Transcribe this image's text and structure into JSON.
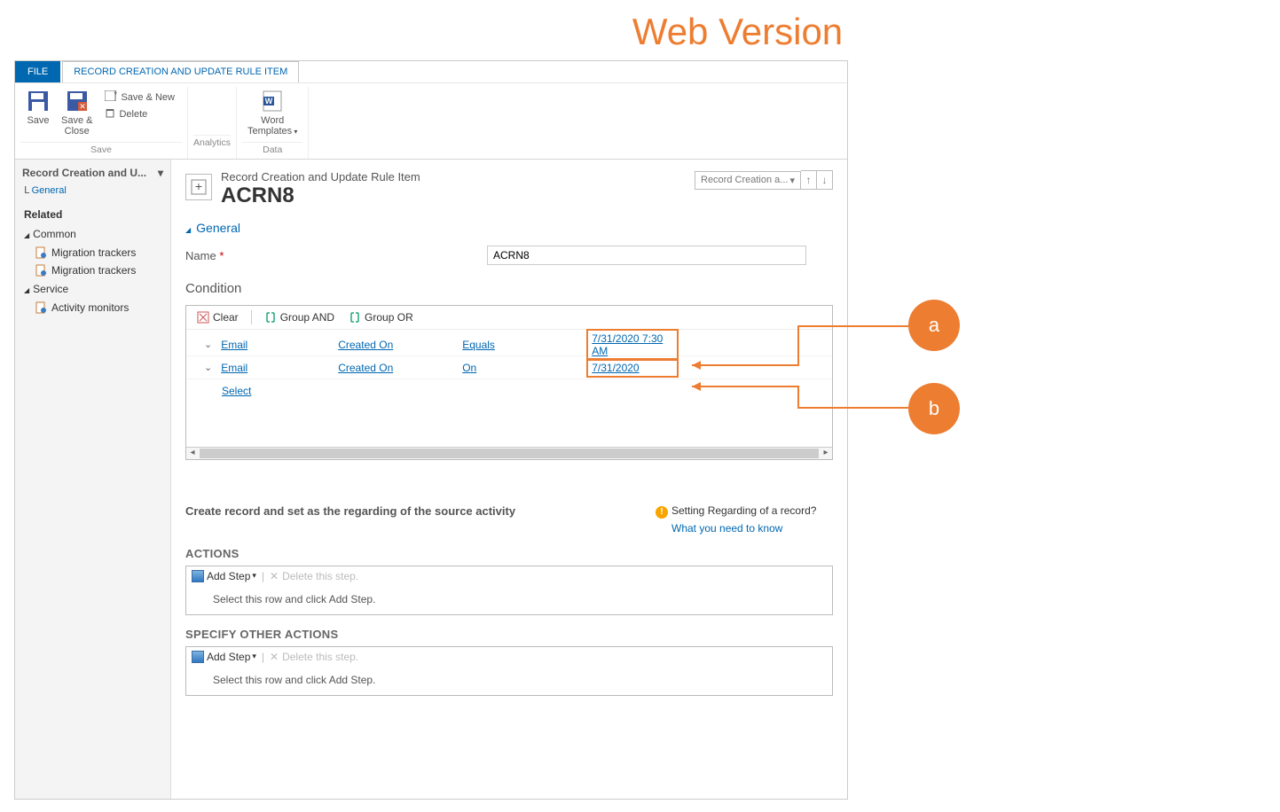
{
  "page": {
    "overlay_title": "Web Version"
  },
  "ribbon": {
    "tabs": {
      "file": "FILE",
      "ruleitem": "RECORD CREATION AND UPDATE RULE ITEM"
    },
    "groups": {
      "save": {
        "save": "Save",
        "save_close": "Save &\nClose",
        "save_new": "Save & New",
        "delete": "Delete",
        "label": "Save"
      },
      "analytics": {
        "label": "Analytics"
      },
      "data": {
        "word_templates": "Word\nTemplates",
        "label": "Data"
      }
    }
  },
  "sidebar": {
    "breadcrumb": "Record Creation and U...",
    "general": "General",
    "related": "Related",
    "common": "Common",
    "common_items": [
      "Migration trackers",
      "Migration trackers"
    ],
    "service": "Service",
    "service_items": [
      "Activity monitors"
    ]
  },
  "header": {
    "subtype": "Record Creation and Update Rule Item",
    "title": "ACRN8",
    "selector": "Record Creation a..."
  },
  "form": {
    "section_general": "General",
    "name_label": "Name",
    "name_value": "ACRN8",
    "condition_label": "Condition",
    "toolbar": {
      "clear": "Clear",
      "group_and": "Group AND",
      "group_or": "Group OR"
    },
    "rows": [
      {
        "entity": "Email",
        "attr": "Created On",
        "op": "Equals",
        "value": "7/31/2020 7:30 AM"
      },
      {
        "entity": "Email",
        "attr": "Created On",
        "op": "On",
        "value": "7/31/2020"
      }
    ],
    "select_label": "Select",
    "regarding_heading": "Create record and set as the regarding of the source activity",
    "tip_heading": "Setting Regarding of a record?",
    "tip_link": "What you need to know",
    "actions_heading": "ACTIONS",
    "specify_heading": "SPECIFY OTHER ACTIONS",
    "add_step": "Add Step",
    "delete_step": "Delete this step.",
    "select_row_hint": "Select this row and click Add Step."
  },
  "annotations": {
    "a": "a",
    "b": "b"
  }
}
